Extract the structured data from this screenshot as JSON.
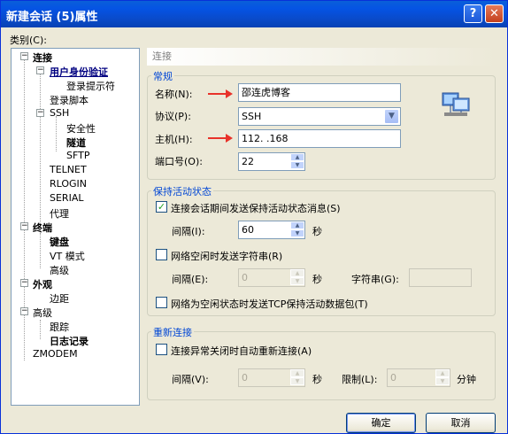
{
  "window": {
    "title": "新建会话 (5)属性",
    "help_glyph": "?",
    "close_glyph": "✕"
  },
  "category_label": "类别(C):",
  "tree": {
    "items": [
      {
        "label": "连接",
        "expand": "−"
      },
      {
        "label": "用户身份验证",
        "expand": "−"
      },
      {
        "label": "登录提示符"
      },
      {
        "label": "登录脚本"
      },
      {
        "label": "SSH",
        "expand": "−"
      },
      {
        "label": "安全性"
      },
      {
        "label": "隧道"
      },
      {
        "label": "SFTP"
      },
      {
        "label": "TELNET"
      },
      {
        "label": "RLOGIN"
      },
      {
        "label": "SERIAL"
      },
      {
        "label": "代理"
      },
      {
        "label": "终端",
        "expand": "−"
      },
      {
        "label": "键盘"
      },
      {
        "label": "VT 模式"
      },
      {
        "label": "高级"
      },
      {
        "label": "外观",
        "expand": "−"
      },
      {
        "label": "边距"
      },
      {
        "label": "高级",
        "expand": "−"
      },
      {
        "label": "跟踪"
      },
      {
        "label": "日志记录"
      },
      {
        "label": "ZMODEM"
      }
    ]
  },
  "panel": {
    "header": "连接",
    "general": {
      "title": "常规",
      "name_label": "名称(N):",
      "name_value": "邵连虎博客",
      "protocol_label": "协议(P):",
      "protocol_value": "SSH",
      "host_label": "主机(H):",
      "host_value": "112.        .168",
      "port_label": "端口号(O):",
      "port_value": "22"
    },
    "keepalive": {
      "title": "保持活动状态",
      "send_msg_label": "连接会话期间发送保持活动状态消息(S)",
      "send_msg_checked": "✓",
      "interval_label": "间隔(I):",
      "interval_value": "60",
      "interval_unit": "秒",
      "idle_string_label": "网络空闲时发送字符串(R)",
      "idle_interval_label": "间隔(E):",
      "idle_interval_value": "0",
      "idle_interval_unit": "秒",
      "string_label": "字符串(G):",
      "string_value": "",
      "tcp_label": "网络为空闲状态时发送TCP保持活动数据包(T)"
    },
    "reconnect": {
      "title": "重新连接",
      "auto_label": "连接异常关闭时自动重新连接(A)",
      "interval_label": "间隔(V):",
      "interval_value": "0",
      "interval_unit": "秒",
      "limit_label": "限制(L):",
      "limit_value": "0",
      "limit_unit": "分钟"
    }
  },
  "buttons": {
    "ok": "确定",
    "cancel": "取消"
  },
  "colors": {
    "titlebar": "#0553e4",
    "accent_arrow": "#e8322a",
    "group_title": "#0046d5"
  }
}
